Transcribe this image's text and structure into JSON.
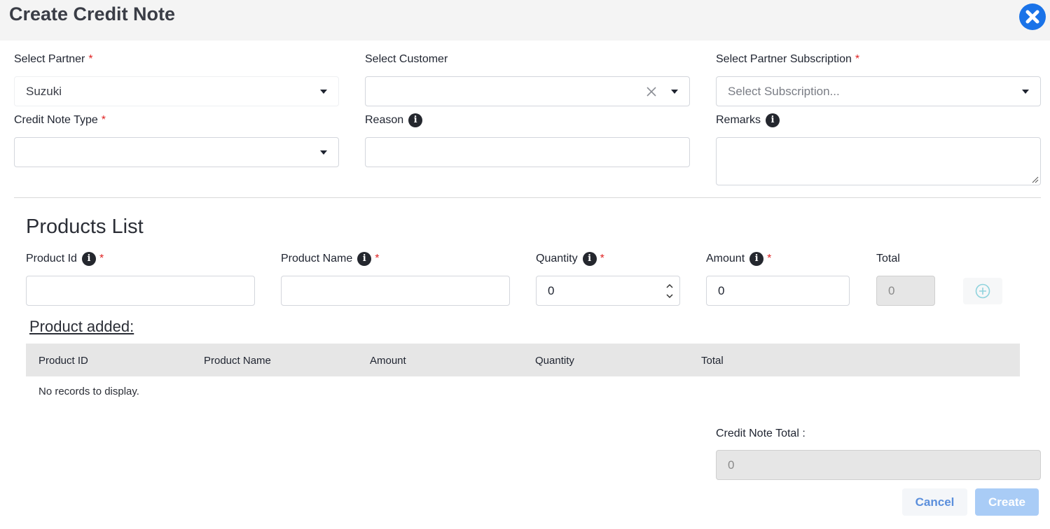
{
  "modal": {
    "title": "Create Credit Note"
  },
  "form": {
    "partner": {
      "label": "Select Partner",
      "required": "*",
      "value": "Suzuki"
    },
    "customer": {
      "label": "Select Customer",
      "value": ""
    },
    "subscription": {
      "label": "Select Partner Subscription",
      "required": "*",
      "placeholder": "Select Subscription..."
    },
    "credit_note_type": {
      "label": "Credit Note Type",
      "required": "*",
      "value": ""
    },
    "reason": {
      "label": "Reason",
      "value": ""
    },
    "remarks": {
      "label": "Remarks",
      "value": ""
    }
  },
  "products": {
    "section_title": "Products List",
    "product_id": {
      "label": "Product Id",
      "required": "*",
      "value": ""
    },
    "product_name": {
      "label": "Product Name",
      "required": "*",
      "value": ""
    },
    "quantity": {
      "label": "Quantity",
      "required": "*",
      "value": "0"
    },
    "amount": {
      "label": "Amount",
      "required": "*",
      "value": "0"
    },
    "total": {
      "label": "Total",
      "value": "0"
    }
  },
  "added": {
    "title": "Product added:",
    "columns": [
      "Product ID",
      "Product Name",
      "Amount",
      "Quantity",
      "Total"
    ],
    "empty_text": "No records to display."
  },
  "summary": {
    "credit_note_total_label": "Credit Note Total :",
    "credit_note_total_value": "0"
  },
  "actions": {
    "cancel_label": "Cancel",
    "create_label": "Create"
  },
  "colors": {
    "accent": "#1a73e8",
    "required": "#e02424",
    "create_disabled": "#a9ccf6"
  }
}
